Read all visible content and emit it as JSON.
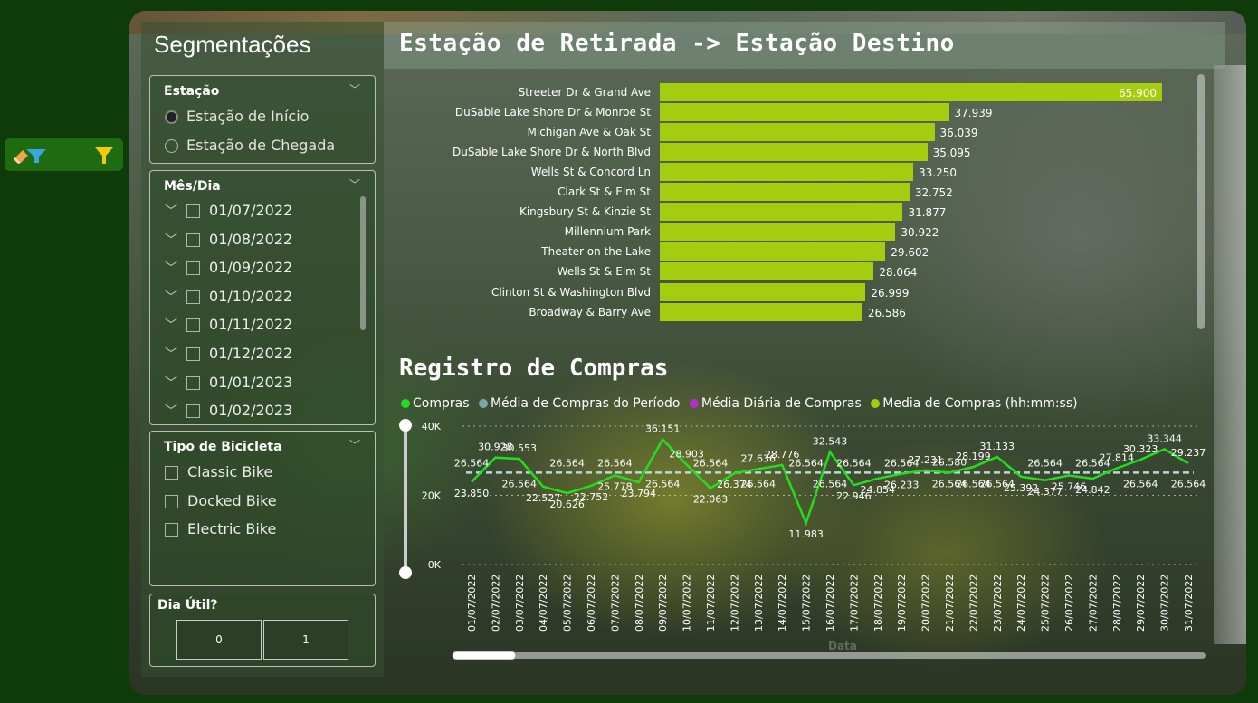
{
  "filter_widget": {
    "eraser_icon": "eraser-filter-icon",
    "funnel_icon": "funnel-icon"
  },
  "slicers": {
    "title": "Segmentações",
    "estacao": {
      "title": "Estação",
      "options": [
        {
          "label": "Estação de Início",
          "selected": true
        },
        {
          "label": "Estação de Chegada",
          "selected": false
        }
      ]
    },
    "mes_dia": {
      "title": "Mês/Dia",
      "items": [
        "01/07/2022",
        "01/08/2022",
        "01/09/2022",
        "01/10/2022",
        "01/11/2022",
        "01/12/2022",
        "01/01/2023",
        "01/02/2023"
      ]
    },
    "tipo_bicicleta": {
      "title": "Tipo de Bicicleta",
      "items": [
        "Classic Bike",
        "Docked Bike",
        "Electric Bike"
      ]
    },
    "dia_util": {
      "title": "Dia Útil?",
      "buttons": [
        "0",
        "1"
      ]
    }
  },
  "station_chart": {
    "title": "Estação de Retirada -> Estação Destino",
    "bar_color": "#a6cc10",
    "chart_data": {
      "type": "bar",
      "orientation": "horizontal",
      "categories": [
        "Streeter Dr & Grand Ave",
        "DuSable Lake Shore Dr & Monroe St",
        "Michigan Ave & Oak St",
        "DuSable Lake Shore Dr & North Blvd",
        "Wells St & Concord Ln",
        "Clark St & Elm St",
        "Kingsbury St & Kinzie St",
        "Millennium Park",
        "Theater on the Lake",
        "Wells St & Elm St",
        "Clinton St & Washington Blvd",
        "Broadway & Barry Ave"
      ],
      "values": [
        65900,
        37939,
        36039,
        35095,
        33250,
        32752,
        31877,
        30922,
        29602,
        28064,
        26999,
        26586
      ],
      "labels": [
        "65.900",
        "37.939",
        "36.039",
        "35.095",
        "33.250",
        "32.752",
        "31.877",
        "30.922",
        "29.602",
        "28.064",
        "26.999",
        "26.586"
      ]
    }
  },
  "purchase_chart": {
    "title": "Registro de Compras",
    "legend": [
      {
        "label": "Compras",
        "color": "#22dd22"
      },
      {
        "label": "Média de Compras do Período",
        "color": "#7aa7a7"
      },
      {
        "label": "Média Diária de Compras",
        "color": "#b030c8"
      },
      {
        "label": "Media de Compras (hh:mm:ss)",
        "color": "#a6cc10"
      }
    ],
    "xlabel": "Data",
    "chart_data": {
      "type": "line",
      "x": [
        "01/07/2022",
        "02/07/2022",
        "03/07/2022",
        "04/07/2022",
        "05/07/2022",
        "06/07/2022",
        "07/07/2022",
        "08/07/2022",
        "09/07/2022",
        "10/07/2022",
        "11/07/2022",
        "12/07/2022",
        "13/07/2022",
        "14/07/2022",
        "15/07/2022",
        "16/07/2022",
        "17/07/2022",
        "18/07/2022",
        "19/07/2022",
        "20/07/2022",
        "21/07/2022",
        "22/07/2022",
        "23/07/2022",
        "24/07/2022",
        "25/07/2022",
        "26/07/2022",
        "27/07/2022",
        "28/07/2022",
        "29/07/2022",
        "30/07/2022",
        "31/07/2022"
      ],
      "series": [
        {
          "name": "Compras",
          "values": [
            23850,
            30928,
            30553,
            22527,
            20626,
            22752,
            25778,
            23794,
            36151,
            28903,
            22063,
            26374,
            27636,
            28776,
            11983,
            32543,
            22946,
            24854,
            26233,
            27231,
            26580,
            28199,
            31133,
            25392,
            24377,
            25746,
            24842,
            27814,
            30323,
            33344,
            29237
          ],
          "labels": [
            "23.850",
            "30.928",
            "30.553",
            "22.527",
            "20.626",
            "22.752",
            "25.778",
            "23.794",
            "36.151",
            "28.903",
            "22.063",
            "26.374",
            "27.636",
            "28.776",
            "11.983",
            "32.543",
            "22.946",
            "24.854",
            "26.233",
            "27.231",
            "26.580",
            "28.199",
            "31.133",
            "25.392",
            "24.377",
            "25.746",
            "24.842",
            "27.814",
            "30.323",
            "33.344",
            "29.237"
          ]
        },
        {
          "name": "Média de Compras do Período",
          "value": 26564,
          "label": "26.564"
        }
      ],
      "yticks": [
        "0K",
        "20K",
        "40K"
      ],
      "ylim": [
        0,
        40000
      ]
    }
  }
}
